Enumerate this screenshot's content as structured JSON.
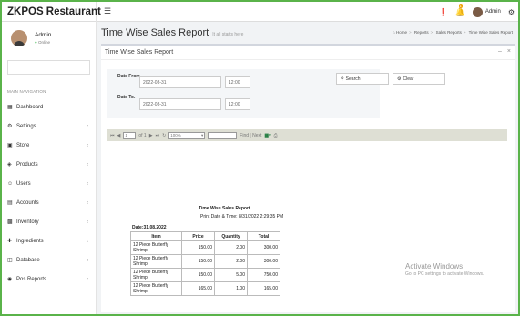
{
  "app": {
    "brand": "ZKPOS Restaurant"
  },
  "topbar": {
    "notif_count": "1",
    "user": "Admin"
  },
  "user": {
    "name": "Admin",
    "status": "Online"
  },
  "sidebar": {
    "header": "MAIN NAVIGATION",
    "items": [
      {
        "label": "Dashboard",
        "icon": "dashboard-icon"
      },
      {
        "label": "Settings",
        "icon": "gear-icon"
      },
      {
        "label": "Store",
        "icon": "store-icon"
      },
      {
        "label": "Products",
        "icon": "cube-icon"
      },
      {
        "label": "Users",
        "icon": "user-icon"
      },
      {
        "label": "Accounts",
        "icon": "accounts-icon"
      },
      {
        "label": "Inventory",
        "icon": "chart-icon"
      },
      {
        "label": "Ingredients",
        "icon": "plus-icon"
      },
      {
        "label": "Database",
        "icon": "database-icon"
      },
      {
        "label": "Pos Reports",
        "icon": "circle-icon"
      }
    ]
  },
  "page": {
    "title": "Time Wise Sales Report",
    "subtitle": "It all starts here",
    "breadcrumb": [
      "Home",
      "Reports",
      "Sales Reports",
      "Time Wise Sales Report"
    ]
  },
  "box": {
    "title": "Time Wise Sales Report"
  },
  "filter": {
    "date_from_label": "Date From.",
    "date_from": "2022-08-31",
    "time_from": "12:00",
    "date_to_label": "Date To.",
    "date_to": "2022-08-31",
    "time_to": "12:00",
    "search_btn": "Search",
    "clear_btn": "Clear"
  },
  "reportviewer": {
    "page": "1",
    "of_pages": "of 1",
    "zoom": "100%",
    "find_next": "Find | Next"
  },
  "report": {
    "title": "Time Wise Sales Report",
    "print_info": "Print Date & Time: 8/31/2022 2:29:35 PM",
    "date_line": "Date:31.08.2022",
    "columns": [
      "Item",
      "Price",
      "Quantity",
      "Total"
    ],
    "rows": [
      {
        "item": "12 Piece Butterfly Shrimp",
        "price": "150.00",
        "qty": "2.00",
        "total": "300.00"
      },
      {
        "item": "12 Piece Butterfly Shrimp",
        "price": "150.00",
        "qty": "2.00",
        "total": "300.00"
      },
      {
        "item": "12 Piece Butterfly Shrimp",
        "price": "150.00",
        "qty": "5.00",
        "total": "750.00"
      },
      {
        "item": "12 Piece Butterfly Shrimp",
        "price": "165.00",
        "qty": "1.00",
        "total": "165.00"
      }
    ]
  },
  "watermark": {
    "line1": "Activate Windows",
    "line2": "Go to PC settings to activate Windows."
  }
}
